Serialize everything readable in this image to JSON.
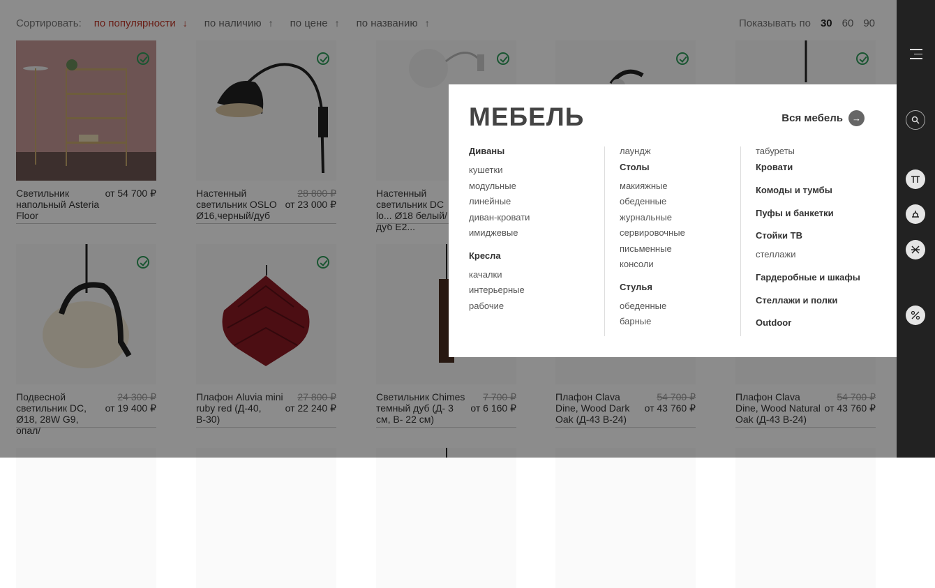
{
  "sort": {
    "label": "Сортировать:",
    "options": [
      {
        "label": "по популярности",
        "arrow": "↓",
        "active": true
      },
      {
        "label": "по наличию",
        "arrow": "↑",
        "active": false
      },
      {
        "label": "по цене",
        "arrow": "↑",
        "active": false
      },
      {
        "label": "по названию",
        "arrow": "↑",
        "active": false
      }
    ]
  },
  "per_page": {
    "label": "Показывать по",
    "options": [
      "30",
      "60",
      "90"
    ],
    "selected": "30"
  },
  "products": [
    {
      "name": "Светильник напольный Asteria Floor",
      "old_price": "",
      "price": "от 54 700 ₽"
    },
    {
      "name": "Настенный светильник OSLO Ø16,черный/дуб",
      "old_price": "28 800 ₽",
      "price": "от 23 000 ₽"
    },
    {
      "name": "Настенный светильник DC lo... Ø18 белый/дуб E2...",
      "old_price": "",
      "price": ""
    },
    {
      "name": "",
      "old_price": "",
      "price": ""
    },
    {
      "name": "",
      "old_price": "",
      "price": ""
    },
    {
      "name": "Подвесной светильник DC, Ø18, 28W G9, опал/",
      "old_price": "24 300 ₽",
      "price": "от 19 400 ₽"
    },
    {
      "name": "Плафон Aluvia mini ruby red (Д-40, В-30)",
      "old_price": "27 800 ₽",
      "price": "от 22 240 ₽"
    },
    {
      "name": "Светильник Chimes темный дуб (Д- 3 см, В- 22 см)",
      "old_price": "7 700 ₽",
      "price": "от 6 160 ₽"
    },
    {
      "name": "Плафон Clava Dine, Wood Dark Oak (Д-43 В-24)",
      "old_price": "54 700 ₽",
      "price": "от 43 760 ₽"
    },
    {
      "name": "Плафон Clava Dine, Wood Natural Oak (Д-43 В-24)",
      "old_price": "54 700 ₽",
      "price": "от 43 760 ₽"
    }
  ],
  "menu": {
    "title": "МЕБЕЛЬ",
    "all_link": "Вся мебель",
    "col1": {
      "sofas": {
        "heading": "Диваны",
        "items": [
          "кушетки",
          "модульные",
          "линейные",
          "диван-кровати",
          "имиджевые"
        ]
      },
      "armchairs": {
        "heading": "Кресла",
        "items": [
          "качалки",
          "интерьерные",
          "рабочие"
        ]
      }
    },
    "col2": {
      "top_item": "лаундж",
      "tables": {
        "heading": "Столы",
        "items": [
          "макияжные",
          "обеденные",
          "журнальные",
          "сервировочные",
          "письменные",
          "консоли"
        ]
      },
      "chairs": {
        "heading": "Стулья",
        "items": [
          "обеденные",
          "барные"
        ]
      }
    },
    "col3": {
      "top_item": "табуреты",
      "headings": [
        "Кровати",
        "Комоды и тумбы",
        "Пуфы и банкетки",
        "Стойки ТВ"
      ],
      "racks_sub": "стеллажи",
      "headings2": [
        "Гардеробные и шкафы",
        "Стеллажи и полки",
        "Outdoor"
      ]
    }
  },
  "rail": {
    "icons": [
      "menu-icon",
      "search-icon",
      "lamp-icon",
      "chair-icon",
      "cross-icon",
      "percent-icon"
    ]
  }
}
